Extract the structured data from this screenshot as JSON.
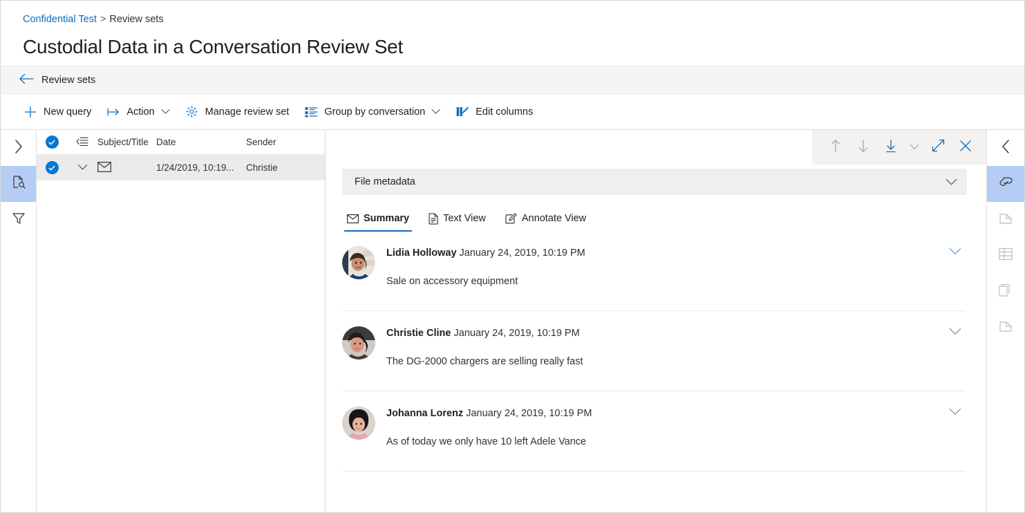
{
  "breadcrumb": {
    "link": "Confidential Test",
    "separator": ">",
    "current": "Review sets"
  },
  "page_title": "Custodial Data in a Conversation Review Set",
  "back_nav": {
    "icon": "arrow-left-icon",
    "label": "Review sets"
  },
  "command_bar": {
    "items": [
      {
        "label": "New query",
        "icon": "plus-icon",
        "chevron": false
      },
      {
        "label": "Action",
        "icon": "arrow-right-bar-icon",
        "chevron": true
      },
      {
        "label": "Manage review set",
        "icon": "gear-icon",
        "chevron": false
      },
      {
        "label": "Group by conversation",
        "icon": "group-list-icon",
        "chevron": true
      },
      {
        "label": "Edit columns",
        "icon": "edit-columns-icon",
        "chevron": false
      }
    ]
  },
  "left_rail": {
    "items": [
      {
        "icon": "chevron-right-icon",
        "selected": false,
        "dim": false
      },
      {
        "icon": "document-search-icon",
        "selected": true,
        "dim": false
      },
      {
        "icon": "filter-funnel-icon",
        "selected": false,
        "dim": false
      }
    ]
  },
  "right_rail": {
    "items": [
      {
        "icon": "chevron-left-icon",
        "selected": false,
        "dim": false
      },
      {
        "icon": "tag-icon",
        "selected": true,
        "dim": false
      },
      {
        "icon": "page-icon",
        "selected": false,
        "dim": true
      },
      {
        "icon": "table-grid-icon",
        "selected": false,
        "dim": true
      },
      {
        "icon": "copy-stack-icon",
        "selected": false,
        "dim": true
      },
      {
        "icon": "page-alt-icon",
        "selected": false,
        "dim": true
      }
    ]
  },
  "list": {
    "columns": [
      "",
      "",
      "",
      "Subject/Title",
      "Date",
      "Sender"
    ],
    "header_icons": {
      "select_all": "checkbox-checked-icon",
      "group": "group-indent-icon"
    },
    "rows": [
      {
        "selected": true,
        "expand_icon": "chevron-down-icon",
        "type_icon": "envelope-icon",
        "subject": "",
        "date": "1/24/2019, 10:19...",
        "sender": "Christie"
      }
    ]
  },
  "detail": {
    "toolbar": [
      {
        "icon": "arrow-up-icon",
        "dim": true
      },
      {
        "icon": "arrow-down-icon",
        "dim": true
      },
      {
        "icon": "download-icon",
        "dim": false
      },
      {
        "icon": "chevron-down-icon",
        "dim": true
      },
      {
        "icon": "expand-diagonal-icon",
        "dim": false
      },
      {
        "icon": "close-icon",
        "dim": false
      }
    ],
    "metadata_bar": {
      "title": "File metadata",
      "chevron": "chevron-down-icon"
    },
    "tabs": [
      {
        "label": "Summary",
        "icon": "envelope-icon",
        "active": true
      },
      {
        "label": "Text View",
        "icon": "document-icon",
        "active": false
      },
      {
        "label": "Annotate View",
        "icon": "annotate-pencil-icon",
        "active": false
      }
    ],
    "messages": [
      {
        "name": "Lidia Holloway",
        "date": "January 24, 2019, 10:19 PM",
        "text": "Sale on accessory equipment",
        "avatar_colors": [
          "#3f4a63",
          "#c4806c",
          "#1f3f7a"
        ],
        "chevron": "chevron-down-icon"
      },
      {
        "name": "Christie Cline",
        "date": "January 24, 2019, 10:19 PM",
        "text": "The DG-2000 chargers are selling really fast",
        "avatar_colors": [
          "#2b2b33",
          "#d39a84",
          "#4a3b36"
        ],
        "chevron": "chevron-down-icon"
      },
      {
        "name": "Johanna Lorenz",
        "date": "January 24, 2019, 10:19 PM",
        "text": "As of today we only have 10 left Adele Vance",
        "avatar_colors": [
          "#1c1a1f",
          "#e0b49c",
          "#e6a6b4"
        ],
        "chevron": "chevron-down-icon"
      }
    ]
  },
  "colors": {
    "accent": "#0f6cbd",
    "checkbox": "#0078d4",
    "rail_selected": "#b5cdf5",
    "row_selected": "#ebebeb",
    "band": "#f3f2f1"
  }
}
